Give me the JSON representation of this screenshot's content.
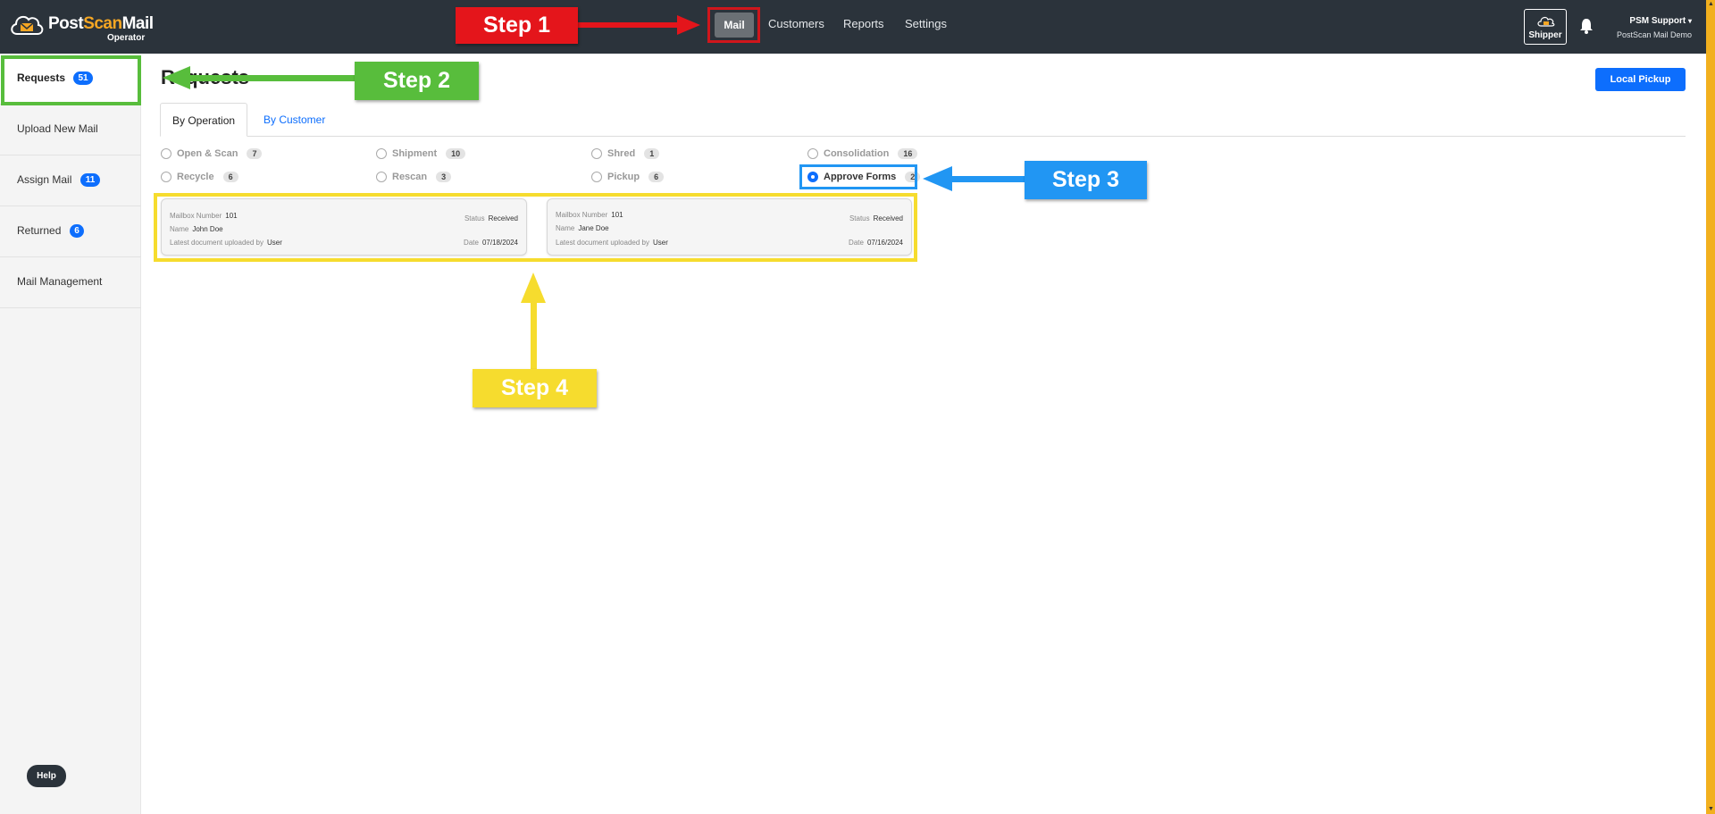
{
  "app": {
    "logo_part1": "Post",
    "logo_part2": "Scan",
    "logo_part3": "Mail",
    "logo_sub": "Operator"
  },
  "nav": {
    "mail": "Mail",
    "customers": "Customers",
    "reports": "Reports",
    "settings": "Settings"
  },
  "header_right": {
    "shipper": "Shipper",
    "user_name": "PSM Support",
    "user_org": "PostScan Mail Demo"
  },
  "sidebar": {
    "items": [
      {
        "label": "Requests",
        "badge": "51"
      },
      {
        "label": "Upload New Mail",
        "badge": ""
      },
      {
        "label": "Assign Mail",
        "badge": "11"
      },
      {
        "label": "Returned",
        "badge": "6"
      },
      {
        "label": "Mail Management",
        "badge": ""
      }
    ],
    "help": "Help"
  },
  "main": {
    "title": "Requests",
    "local_pickup": "Local Pickup",
    "tabs": [
      "By Operation",
      "By Customer"
    ],
    "operations": [
      {
        "label": "Open & Scan",
        "count": "7",
        "checked": false
      },
      {
        "label": "Shipment",
        "count": "10",
        "checked": false
      },
      {
        "label": "Shred",
        "count": "1",
        "checked": false
      },
      {
        "label": "Consolidation",
        "count": "16",
        "checked": false
      },
      {
        "label": "Recycle",
        "count": "6",
        "checked": false
      },
      {
        "label": "Rescan",
        "count": "3",
        "checked": false
      },
      {
        "label": "Pickup",
        "count": "6",
        "checked": false
      },
      {
        "label": "Approve Forms",
        "count": "2",
        "checked": true
      }
    ],
    "card_labels": {
      "mailbox": "Mailbox Number",
      "name": "Name",
      "uploaded_by": "Latest document uploaded by",
      "status": "Status",
      "date": "Date"
    },
    "cards": [
      {
        "mailbox": "101",
        "name": "John Doe",
        "uploaded_by": "User",
        "status": "Received",
        "date": "07/18/2024"
      },
      {
        "mailbox": "101",
        "name": "Jane Doe",
        "uploaded_by": "User",
        "status": "Received",
        "date": "07/16/2024"
      }
    ]
  },
  "annotations": {
    "step1": "Step 1",
    "step2": "Step 2",
    "step3": "Step 3",
    "step4": "Step 4"
  },
  "colors": {
    "topbar": "#2b333b",
    "primary": "#0d6efd",
    "step1_red": "#e4151b",
    "step2_green": "#58bd3c",
    "step3_blue": "#2196f3",
    "step4_yellow": "#f6dc2e"
  }
}
